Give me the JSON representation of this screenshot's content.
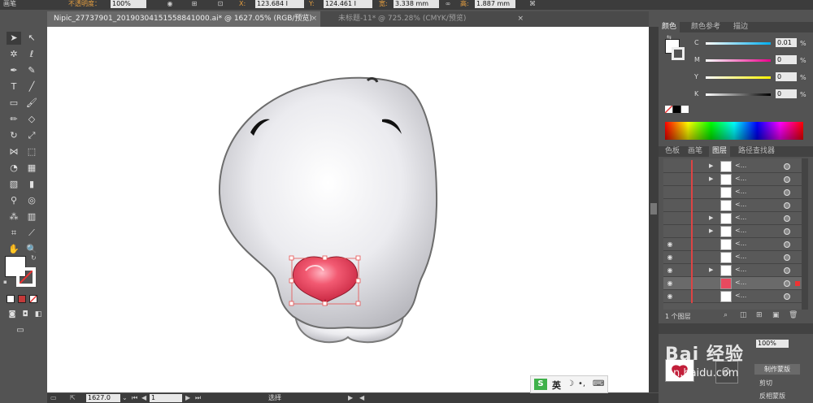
{
  "control_bar": {
    "stroke_label": "画笔",
    "opacity_label": "不透明度：",
    "opacity_value": "100%",
    "x_label": "X:",
    "x_value": "123.684 I",
    "y_label": "Y:",
    "y_value": "124.461 I",
    "w_label": "宽:",
    "w_value": "3.338 mm",
    "h_label": "高:",
    "h_value": "1.887 mm"
  },
  "tabs": [
    {
      "label": "Nipic_27737901_20190304151558841000.ai* @ 1627.05% (RGB/预览)"
    },
    {
      "label": "未标题-11* @ 725.28% (CMYK/预览)"
    }
  ],
  "close_glyph": "×",
  "panels": {
    "color": {
      "tabs": [
        "颜色",
        "颜色参考",
        "描边"
      ],
      "channels": [
        {
          "label": "C",
          "value": "0.01",
          "unit": "%",
          "color": "#00aeef"
        },
        {
          "label": "M",
          "value": "0",
          "unit": "%",
          "color": "#ec008c"
        },
        {
          "label": "Y",
          "value": "0",
          "unit": "%",
          "color": "#fff200"
        },
        {
          "label": "K",
          "value": "0",
          "unit": "%",
          "color": "#000000"
        }
      ]
    },
    "layers": {
      "tabs": [
        "色板",
        "画笔",
        "图层",
        "路径查找器"
      ],
      "footer_label": "1 个图层"
    },
    "transparency": {
      "make_mask": "制作蒙版",
      "clip": "剪切",
      "invert": "反相蒙版",
      "opacity_value": "100%"
    }
  },
  "status_bar": {
    "zoom": "1627.0",
    "page": "1",
    "mode": "选择"
  },
  "ime": {
    "label": "英"
  },
  "watermark": {
    "brand": "Bai 经验",
    "url": "an.baidu.com"
  },
  "colors": {
    "accent": "#e8a040",
    "heart": "#e84a5f",
    "panel_bg": "#535353"
  }
}
